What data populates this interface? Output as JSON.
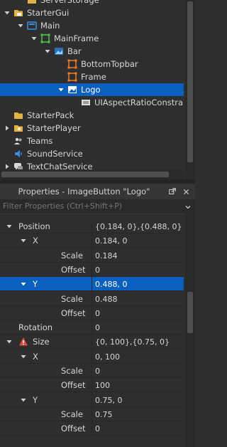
{
  "explorer": {
    "items": [
      {
        "label": "ServerStorage",
        "depth": 1,
        "arrow": "none",
        "icon": "folder-icon",
        "selected": false
      },
      {
        "label": "StarterGui",
        "depth": 0,
        "arrow": "down",
        "icon": "startergui-icon",
        "selected": false
      },
      {
        "label": "Main",
        "depth": 1,
        "arrow": "down",
        "icon": "screengui-icon",
        "selected": false
      },
      {
        "label": "MainFrame",
        "depth": 2,
        "arrow": "down",
        "icon": "frame-icon",
        "selected": false
      },
      {
        "label": "Bar",
        "depth": 3,
        "arrow": "down",
        "icon": "imagelabel-icon",
        "selected": false
      },
      {
        "label": "BottomTopbar",
        "depth": 4,
        "arrow": "none",
        "icon": "frame-orange-icon",
        "selected": false
      },
      {
        "label": "Frame",
        "depth": 4,
        "arrow": "none",
        "icon": "frame-orange-icon",
        "selected": false
      },
      {
        "label": "Logo",
        "depth": 4,
        "arrow": "down",
        "icon": "imagebutton-icon",
        "selected": true
      },
      {
        "label": "UIAspectRatioConstra",
        "depth": 5,
        "arrow": "none",
        "icon": "constraint-icon",
        "selected": false
      },
      {
        "label": "StarterPack",
        "depth": 0,
        "arrow": "none",
        "icon": "starterpack-icon",
        "selected": false
      },
      {
        "label": "StarterPlayer",
        "depth": 0,
        "arrow": "right",
        "icon": "starterplayer-icon",
        "selected": false
      },
      {
        "label": "Teams",
        "depth": 0,
        "arrow": "none",
        "icon": "teams-icon",
        "selected": false
      },
      {
        "label": "SoundService",
        "depth": 0,
        "arrow": "none",
        "icon": "sound-icon",
        "selected": false
      },
      {
        "label": "TextChatService",
        "depth": 0,
        "arrow": "right",
        "icon": "textchat-icon",
        "selected": false
      }
    ]
  },
  "properties": {
    "title": "Properties - ImageButton \"Logo\"",
    "filter_placeholder": "Filter Properties (Ctrl+Shift+P)",
    "rows": [
      {
        "name": "Position",
        "value": "{0.184, 0},{0.488, 0}",
        "depth": 0,
        "arrow": "down",
        "warn": false,
        "selected": false
      },
      {
        "name": "X",
        "value": "0.184, 0",
        "depth": 1,
        "arrow": "down",
        "warn": false,
        "selected": false
      },
      {
        "name": "Scale",
        "value": "0.184",
        "depth": 2,
        "arrow": "none",
        "warn": false,
        "selected": false
      },
      {
        "name": "Offset",
        "value": "0",
        "depth": 2,
        "arrow": "none",
        "warn": false,
        "selected": false
      },
      {
        "name": "Y",
        "value": "0.488, 0",
        "depth": 1,
        "arrow": "down",
        "warn": false,
        "selected": true
      },
      {
        "name": "Scale",
        "value": "0.488",
        "depth": 2,
        "arrow": "none",
        "warn": false,
        "selected": false
      },
      {
        "name": "Offset",
        "value": "0",
        "depth": 2,
        "arrow": "none",
        "warn": false,
        "selected": false
      },
      {
        "name": "Rotation",
        "value": "0",
        "depth": 0,
        "arrow": "none",
        "warn": false,
        "selected": false
      },
      {
        "name": "Size",
        "value": "{0, 100},{0.75, 0}",
        "depth": 0,
        "arrow": "down",
        "warn": true,
        "selected": false
      },
      {
        "name": "X",
        "value": "0, 100",
        "depth": 1,
        "arrow": "down",
        "warn": false,
        "selected": false
      },
      {
        "name": "Scale",
        "value": "0",
        "depth": 2,
        "arrow": "none",
        "warn": false,
        "selected": false
      },
      {
        "name": "Offset",
        "value": "100",
        "depth": 2,
        "arrow": "none",
        "warn": false,
        "selected": false
      },
      {
        "name": "Y",
        "value": "0.75, 0",
        "depth": 1,
        "arrow": "down",
        "warn": false,
        "selected": false
      },
      {
        "name": "Scale",
        "value": "0.75",
        "depth": 2,
        "arrow": "none",
        "warn": false,
        "selected": false
      },
      {
        "name": "Offset",
        "value": "0",
        "depth": 2,
        "arrow": "none",
        "warn": false,
        "selected": false
      }
    ]
  },
  "icons": {
    "popout": "popout-icon",
    "close": "close-icon",
    "filter_dropdown": "chevron-down-icon"
  },
  "colors": {
    "selection": "#0b5fbf",
    "background": "#2e2e2e",
    "warning": "#e0483e"
  }
}
